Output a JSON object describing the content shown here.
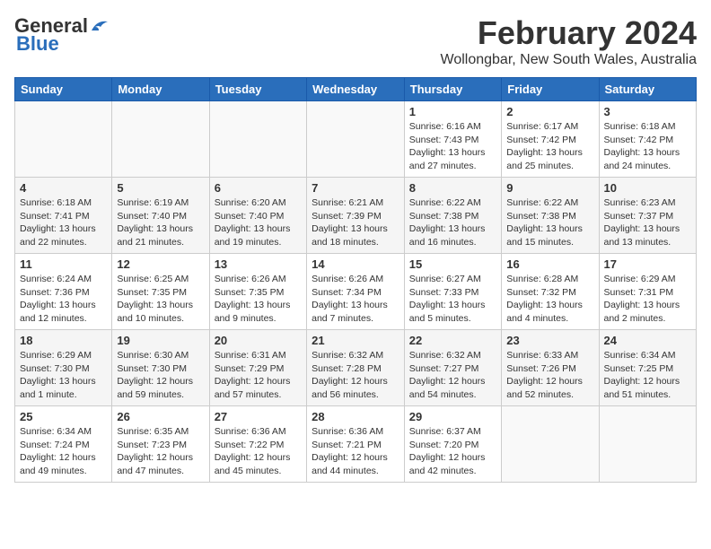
{
  "header": {
    "logo_general": "General",
    "logo_blue": "Blue",
    "month_year": "February 2024",
    "location": "Wollongbar, New South Wales, Australia"
  },
  "weekdays": [
    "Sunday",
    "Monday",
    "Tuesday",
    "Wednesday",
    "Thursday",
    "Friday",
    "Saturday"
  ],
  "weeks": [
    [
      {
        "day": "",
        "text": ""
      },
      {
        "day": "",
        "text": ""
      },
      {
        "day": "",
        "text": ""
      },
      {
        "day": "",
        "text": ""
      },
      {
        "day": "1",
        "text": "Sunrise: 6:16 AM\nSunset: 7:43 PM\nDaylight: 13 hours\nand 27 minutes."
      },
      {
        "day": "2",
        "text": "Sunrise: 6:17 AM\nSunset: 7:42 PM\nDaylight: 13 hours\nand 25 minutes."
      },
      {
        "day": "3",
        "text": "Sunrise: 6:18 AM\nSunset: 7:42 PM\nDaylight: 13 hours\nand 24 minutes."
      }
    ],
    [
      {
        "day": "4",
        "text": "Sunrise: 6:18 AM\nSunset: 7:41 PM\nDaylight: 13 hours\nand 22 minutes."
      },
      {
        "day": "5",
        "text": "Sunrise: 6:19 AM\nSunset: 7:40 PM\nDaylight: 13 hours\nand 21 minutes."
      },
      {
        "day": "6",
        "text": "Sunrise: 6:20 AM\nSunset: 7:40 PM\nDaylight: 13 hours\nand 19 minutes."
      },
      {
        "day": "7",
        "text": "Sunrise: 6:21 AM\nSunset: 7:39 PM\nDaylight: 13 hours\nand 18 minutes."
      },
      {
        "day": "8",
        "text": "Sunrise: 6:22 AM\nSunset: 7:38 PM\nDaylight: 13 hours\nand 16 minutes."
      },
      {
        "day": "9",
        "text": "Sunrise: 6:22 AM\nSunset: 7:38 PM\nDaylight: 13 hours\nand 15 minutes."
      },
      {
        "day": "10",
        "text": "Sunrise: 6:23 AM\nSunset: 7:37 PM\nDaylight: 13 hours\nand 13 minutes."
      }
    ],
    [
      {
        "day": "11",
        "text": "Sunrise: 6:24 AM\nSunset: 7:36 PM\nDaylight: 13 hours\nand 12 minutes."
      },
      {
        "day": "12",
        "text": "Sunrise: 6:25 AM\nSunset: 7:35 PM\nDaylight: 13 hours\nand 10 minutes."
      },
      {
        "day": "13",
        "text": "Sunrise: 6:26 AM\nSunset: 7:35 PM\nDaylight: 13 hours\nand 9 minutes."
      },
      {
        "day": "14",
        "text": "Sunrise: 6:26 AM\nSunset: 7:34 PM\nDaylight: 13 hours\nand 7 minutes."
      },
      {
        "day": "15",
        "text": "Sunrise: 6:27 AM\nSunset: 7:33 PM\nDaylight: 13 hours\nand 5 minutes."
      },
      {
        "day": "16",
        "text": "Sunrise: 6:28 AM\nSunset: 7:32 PM\nDaylight: 13 hours\nand 4 minutes."
      },
      {
        "day": "17",
        "text": "Sunrise: 6:29 AM\nSunset: 7:31 PM\nDaylight: 13 hours\nand 2 minutes."
      }
    ],
    [
      {
        "day": "18",
        "text": "Sunrise: 6:29 AM\nSunset: 7:30 PM\nDaylight: 13 hours\nand 1 minute."
      },
      {
        "day": "19",
        "text": "Sunrise: 6:30 AM\nSunset: 7:30 PM\nDaylight: 12 hours\nand 59 minutes."
      },
      {
        "day": "20",
        "text": "Sunrise: 6:31 AM\nSunset: 7:29 PM\nDaylight: 12 hours\nand 57 minutes."
      },
      {
        "day": "21",
        "text": "Sunrise: 6:32 AM\nSunset: 7:28 PM\nDaylight: 12 hours\nand 56 minutes."
      },
      {
        "day": "22",
        "text": "Sunrise: 6:32 AM\nSunset: 7:27 PM\nDaylight: 12 hours\nand 54 minutes."
      },
      {
        "day": "23",
        "text": "Sunrise: 6:33 AM\nSunset: 7:26 PM\nDaylight: 12 hours\nand 52 minutes."
      },
      {
        "day": "24",
        "text": "Sunrise: 6:34 AM\nSunset: 7:25 PM\nDaylight: 12 hours\nand 51 minutes."
      }
    ],
    [
      {
        "day": "25",
        "text": "Sunrise: 6:34 AM\nSunset: 7:24 PM\nDaylight: 12 hours\nand 49 minutes."
      },
      {
        "day": "26",
        "text": "Sunrise: 6:35 AM\nSunset: 7:23 PM\nDaylight: 12 hours\nand 47 minutes."
      },
      {
        "day": "27",
        "text": "Sunrise: 6:36 AM\nSunset: 7:22 PM\nDaylight: 12 hours\nand 45 minutes."
      },
      {
        "day": "28",
        "text": "Sunrise: 6:36 AM\nSunset: 7:21 PM\nDaylight: 12 hours\nand 44 minutes."
      },
      {
        "day": "29",
        "text": "Sunrise: 6:37 AM\nSunset: 7:20 PM\nDaylight: 12 hours\nand 42 minutes."
      },
      {
        "day": "",
        "text": ""
      },
      {
        "day": "",
        "text": ""
      }
    ]
  ]
}
